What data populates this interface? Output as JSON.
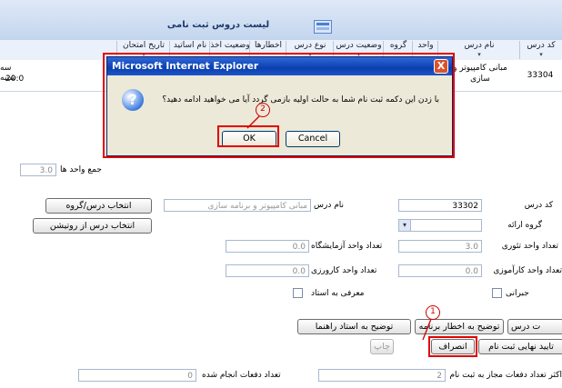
{
  "grid": {
    "title": "لیست دروس ثبت نامی",
    "columns": [
      "کد درس",
      "نام درس",
      "واحد",
      "گروه",
      "وضعیت درس",
      "نوع درس",
      "اخطارها",
      "وضعیت اخذ",
      "نام اساتید",
      "تاریخ امتحان"
    ],
    "row": {
      "code": "33304",
      "name_line1": "مبانی کامپیوتر و",
      "name_line2": "سازی",
      "exam_line1": "سه شنبه",
      "exam_line2": "20:0"
    }
  },
  "total_units": {
    "label": "جمع واحد ها",
    "value": "3.0"
  },
  "form": {
    "course_code_label": "کد درس",
    "course_code_value": "33302",
    "course_name_label": "نام درس",
    "course_name_value": "مبانی کامپیوتر و برنامه سازی",
    "offering_group_label": "گروه ارائه",
    "theory_units_label": "تعداد واحد تئوری",
    "theory_units_value": "3.0",
    "lab_units_label": "تعداد واحد آزمایشگاه",
    "lab_units_value": "0.0",
    "training_units_label": "تعداد واحد کارآموزی",
    "training_units_value": "0.0",
    "workshop_units_label": "تعداد واحد کارورزی",
    "workshop_units_value": "0.0",
    "compensatory_label": "جبرانی",
    "intro_to_master_label": "معرفی به استاد",
    "select_course_button": "انتخاب درس/گروه",
    "select_from_routine_button": "انتخاب درس از روتیشن",
    "allowed_attempts_label": "اکثر تعداد دفعات مجاز به ثبت نام",
    "allowed_attempts_value": "2",
    "done_attempts_label": "تعداد دفعات انجام شده",
    "done_attempts_value": "0"
  },
  "buttons": {
    "course_button_partial": "ت درس",
    "warning_explanation": "توضیح به اخطار برنامه",
    "advisor_explanation": "توضیح به استاد راهنما",
    "final_confirm": "تایید نهایی ثبت نام",
    "cancel": "انصراف",
    "print": "چاپ"
  },
  "dialog": {
    "title": "Microsoft Internet Explorer",
    "message": "با زدن این دکمه ثبت نام شما به حالت اولیه بازمی گردد آیا می خواهید ادامه دهید؟",
    "ok": "OK",
    "cancel": "Cancel",
    "close_glyph": "X",
    "icon_glyph": "?"
  },
  "callouts": {
    "one": "1",
    "two": "2"
  },
  "colors": {
    "highlight": "#e00000",
    "dialog_title": "#0b3fae",
    "grid_header": "#c3d5ee"
  }
}
